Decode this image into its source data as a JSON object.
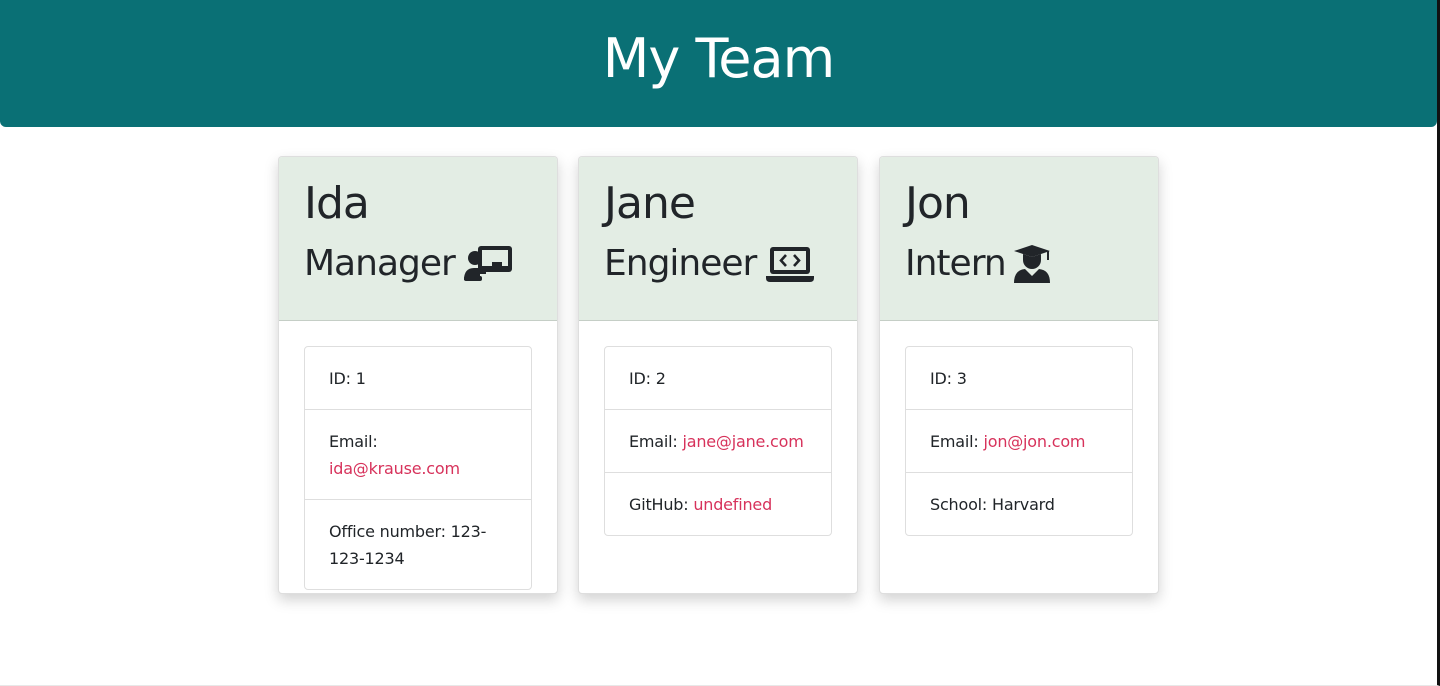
{
  "header": {
    "title": "My Team"
  },
  "colors": {
    "header_bg": "#0a7075",
    "card_header_bg": "#e3ede4",
    "link": "#d7325b"
  },
  "employees": [
    {
      "name": "Ida",
      "role": "Manager",
      "icon": "chalkboard-teacher-icon",
      "id_label": "ID: 1",
      "email_label": "Email:",
      "email": "ida@krause.com",
      "extra_label": "Office number: 123-123-1234",
      "extra_link": ""
    },
    {
      "name": "Jane",
      "role": "Engineer",
      "icon": "laptop-code-icon",
      "id_label": "ID: 2",
      "email_label": "Email:",
      "email": "jane@jane.com",
      "extra_label": "GitHub:",
      "extra_link": "undefined"
    },
    {
      "name": "Jon",
      "role": "Intern",
      "icon": "user-graduate-icon",
      "id_label": "ID: 3",
      "email_label": "Email:",
      "email": "jon@jon.com",
      "extra_label": "School: Harvard",
      "extra_link": ""
    }
  ]
}
